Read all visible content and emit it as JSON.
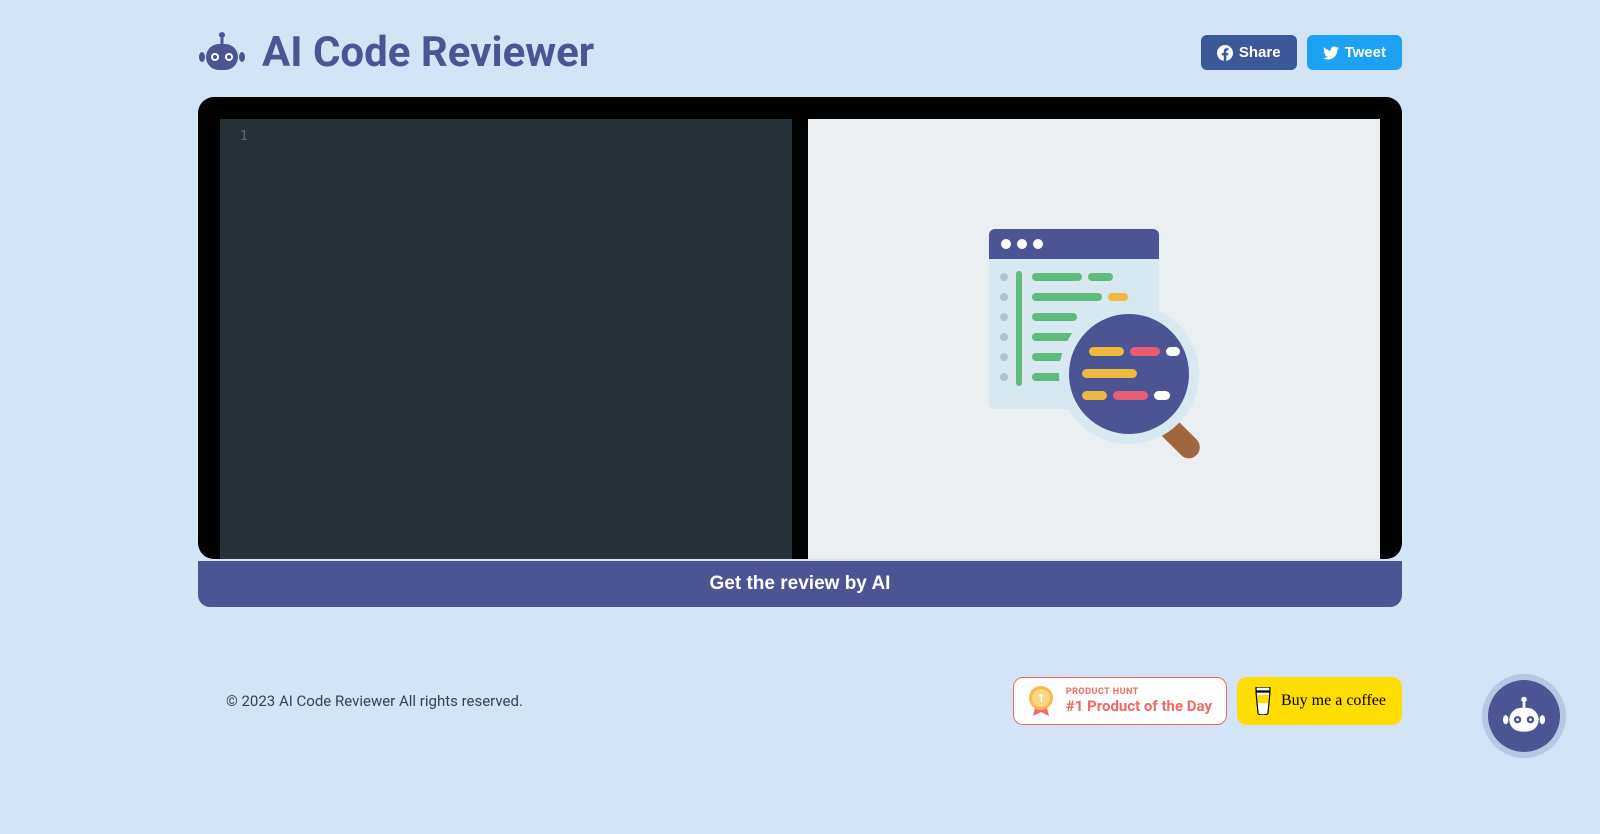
{
  "header": {
    "title": "AI Code Reviewer",
    "share_label": "Share",
    "tweet_label": "Tweet"
  },
  "editor": {
    "line_number": "1"
  },
  "main": {
    "review_button": "Get the review by AI"
  },
  "footer": {
    "copyright": "© 2023 AI Code Reviewer All rights reserved.",
    "product_hunt_label": "PRODUCT HUNT",
    "product_hunt_title": "#1 Product of the Day",
    "coffee_label": "Buy me a coffee"
  }
}
